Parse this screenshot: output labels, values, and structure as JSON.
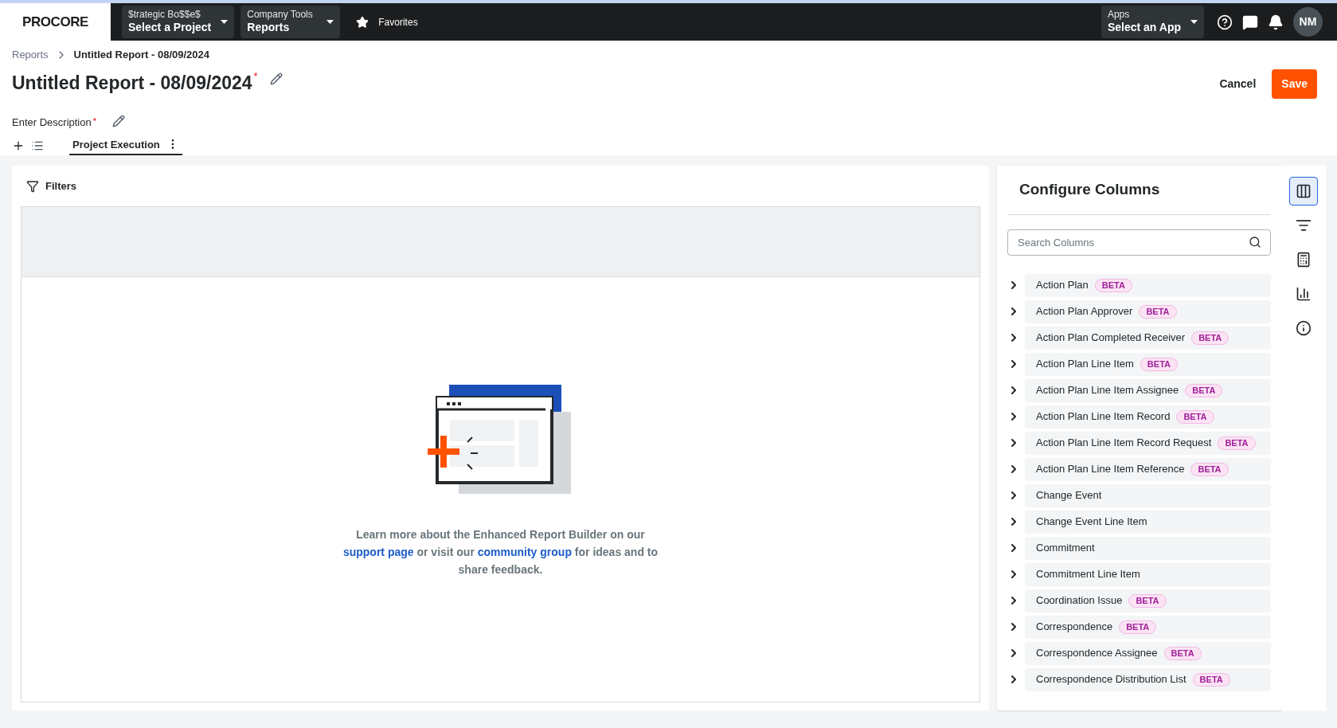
{
  "topbar": {
    "logo": "PROCORE",
    "project": {
      "label": "$trategic Bo$$e$",
      "value": "Select a Project"
    },
    "tool": {
      "label": "Company Tools",
      "value": "Reports"
    },
    "favorites": "Favorites",
    "apps": {
      "label": "Apps",
      "value": "Select an App"
    },
    "avatar": "NM"
  },
  "breadcrumb": [
    {
      "text": "Reports",
      "current": false
    },
    {
      "text": "Untitled Report - 08/09/2024",
      "current": true
    }
  ],
  "title": "Untitled Report - 08/09/2024",
  "required_mark": "*",
  "description": "Enter Description",
  "actions": {
    "cancel": "Cancel",
    "save": "Save"
  },
  "tabs": [
    {
      "label": "Project Execution",
      "selected": true
    }
  ],
  "filters": "Filters",
  "help_text": [
    {
      "kind": "text",
      "text": "Learn more about the Enhanced Report Builder on our "
    },
    {
      "kind": "link",
      "text": "support page"
    },
    {
      "kind": "text",
      "text": " or visit our "
    },
    {
      "kind": "link",
      "text": "community group"
    },
    {
      "kind": "text",
      "text": " for ideas and to share feedback."
    }
  ],
  "panel": {
    "title": "Configure Columns",
    "search_placeholder": "Search Columns",
    "columns": [
      {
        "name": "Action Plan",
        "badge": "BETA"
      },
      {
        "name": "Action Plan Approver",
        "badge": "BETA"
      },
      {
        "name": "Action Plan Completed Receiver",
        "badge": "BETA"
      },
      {
        "name": "Action Plan Line Item",
        "badge": "BETA"
      },
      {
        "name": "Action Plan Line Item Assignee",
        "badge": "BETA"
      },
      {
        "name": "Action Plan Line Item Record",
        "badge": "BETA"
      },
      {
        "name": "Action Plan Line Item Record Request",
        "badge": "BETA"
      },
      {
        "name": "Action Plan Line Item Reference",
        "badge": "BETA"
      },
      {
        "name": "Change Event"
      },
      {
        "name": "Change Event Line Item"
      },
      {
        "name": "Commitment"
      },
      {
        "name": "Commitment Line Item"
      },
      {
        "name": "Coordination Issue",
        "badge": "BETA"
      },
      {
        "name": "Correspondence",
        "badge": "BETA"
      },
      {
        "name": "Correspondence Assignee",
        "badge": "BETA"
      },
      {
        "name": "Correspondence Distribution List",
        "badge": "BETA"
      }
    ]
  },
  "side_tools": [
    {
      "kind": "columns",
      "selected": true
    },
    {
      "kind": "filter",
      "selected": false
    },
    {
      "kind": "calculator",
      "selected": false
    },
    {
      "kind": "chart",
      "selected": false
    },
    {
      "kind": "info",
      "selected": false
    }
  ]
}
